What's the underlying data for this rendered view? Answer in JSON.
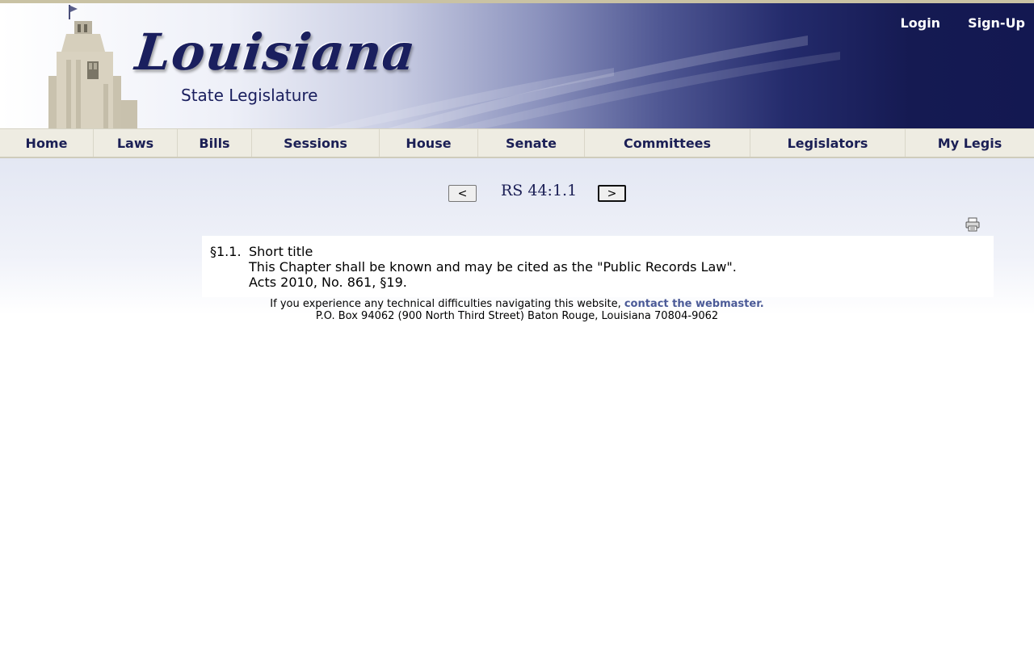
{
  "header": {
    "logo_title": "Louisiana",
    "logo_subtitle": "State Legislature",
    "login_label": "Login",
    "signup_label": "Sign-Up"
  },
  "nav": {
    "items": [
      {
        "label": "Home"
      },
      {
        "label": "Laws"
      },
      {
        "label": "Bills"
      },
      {
        "label": "Sessions"
      },
      {
        "label": "House"
      },
      {
        "label": "Senate"
      },
      {
        "label": "Committees"
      },
      {
        "label": "Legislators"
      },
      {
        "label": "My Legis"
      }
    ]
  },
  "pager": {
    "prev_label": "<",
    "title": "RS 44:1.1",
    "next_label": ">"
  },
  "icons": {
    "print": "print-icon"
  },
  "law": {
    "section_number": "§1.1.",
    "section_title": "Short title",
    "text": "This Chapter shall be known and may be cited as the \"Public Records Law\".",
    "history": "Acts 2010, No. 861, §19."
  },
  "footer": {
    "line1_text": "If you experience any technical difficulties navigating this website, ",
    "webmaster_link": "contact the webmaster.",
    "address": "P.O. Box 94062 (900 North Third Street) Baton Rouge, Louisiana 70804-9062"
  },
  "colors": {
    "nav_text": "#1b1f55",
    "banner_dark": "#131851",
    "link": "#4b5a97"
  }
}
